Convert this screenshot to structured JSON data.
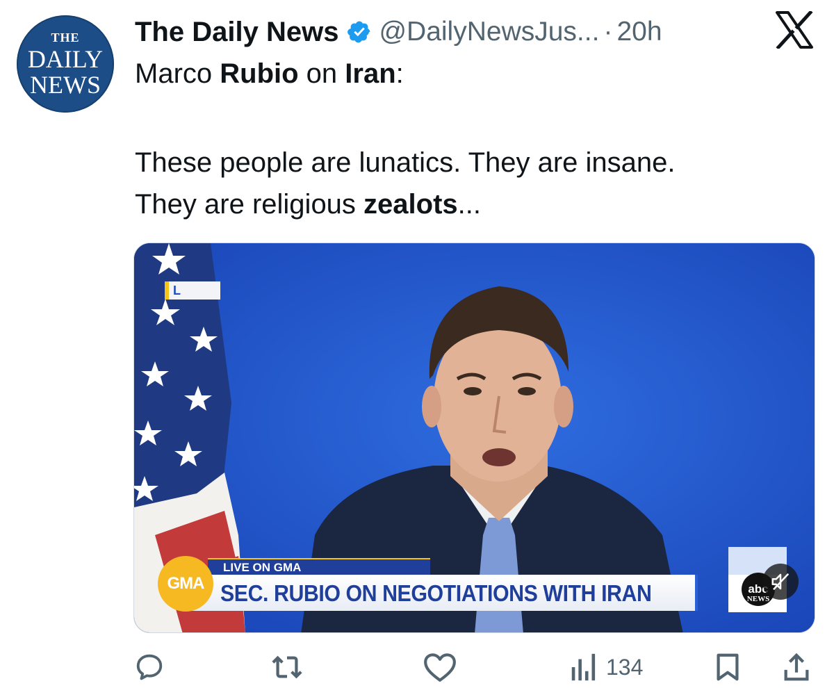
{
  "post": {
    "avatar": {
      "line1": "THE",
      "line2": "DAILY",
      "line3": "NEWS"
    },
    "display_name": "The Daily News",
    "handle": "@DailyNewsJus...",
    "separator": "·",
    "time": "20h",
    "text": {
      "l1_a": "Marco ",
      "l1_b": "Rubio",
      "l1_c": " on ",
      "l1_d": "Iran",
      "l1_e": ":",
      "l3": "These people are lunatics. They are insane.",
      "l4_a": "They are religious ",
      "l4_b": "zealots",
      "l4_c": "..."
    },
    "media": {
      "bug_letter": "L",
      "live_tag": "LIVE ON GMA",
      "logo": "GMA",
      "chyron": "SEC. RUBIO ON NEGOTIATIONS WITH IRAN",
      "network_logo": "abc",
      "network_word": "NEWS"
    },
    "actions": {
      "reply_icon": "reply-icon",
      "repost_icon": "repost-icon",
      "like_icon": "heart-icon",
      "views_icon": "views-icon",
      "views_count": "134",
      "bookmark_icon": "bookmark-icon",
      "share_icon": "share-icon"
    },
    "colors": {
      "verified": "#1d9bf0",
      "muted_text": "#536471",
      "text": "#0f1419",
      "avatar_bg": "#1d4d86"
    }
  }
}
